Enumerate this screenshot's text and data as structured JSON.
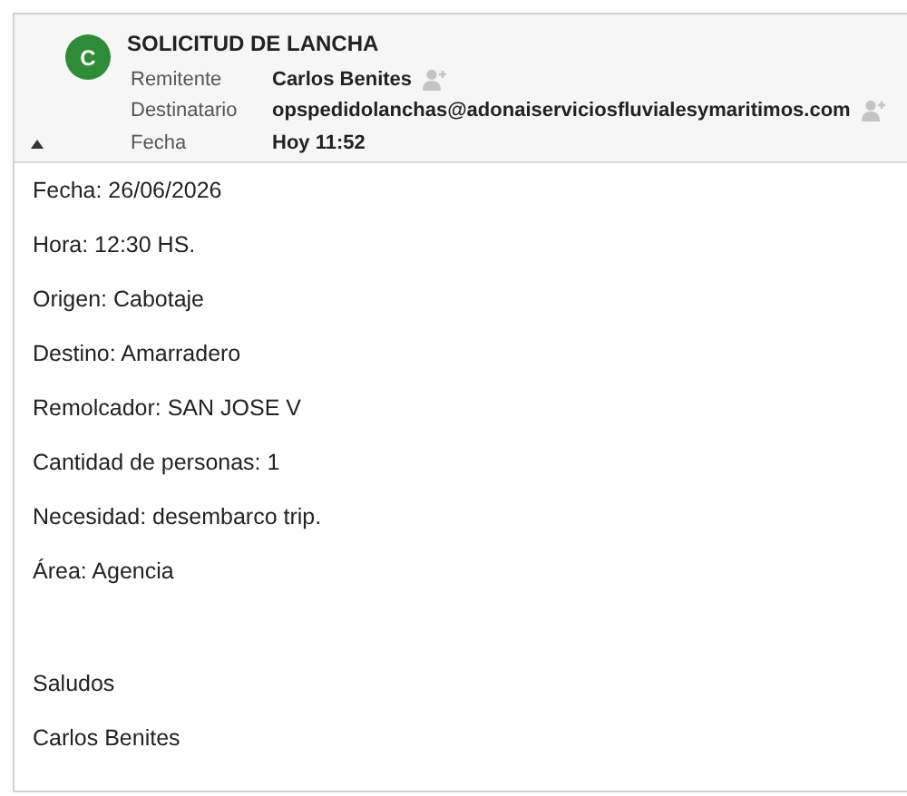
{
  "message": {
    "avatar_initial": "C",
    "subject": "SOLICITUD DE LANCHA",
    "fields": [
      {
        "label": "Remitente",
        "value": "Carlos Benites",
        "add_contact": true
      },
      {
        "label": "Destinatario",
        "value": "opspedidolanchas@adonaiserviciosfluvialesymaritimos.com",
        "add_contact": true
      },
      {
        "label": "Fecha",
        "value": "Hoy 11:52",
        "add_contact": false
      }
    ],
    "header_expanded": true
  },
  "body_lines": [
    "Fecha: 26/06/2026",
    "Hora: 12:30 HS.",
    "Origen: Cabotaje",
    "Destino: Amarradero",
    "Remolcador: SAN JOSE V",
    "Cantidad de personas: 1",
    "Necesidad: desembarco trip.",
    "Área: Agencia"
  ],
  "closing_lines": [
    "Saludos",
    "Carlos Benites"
  ]
}
